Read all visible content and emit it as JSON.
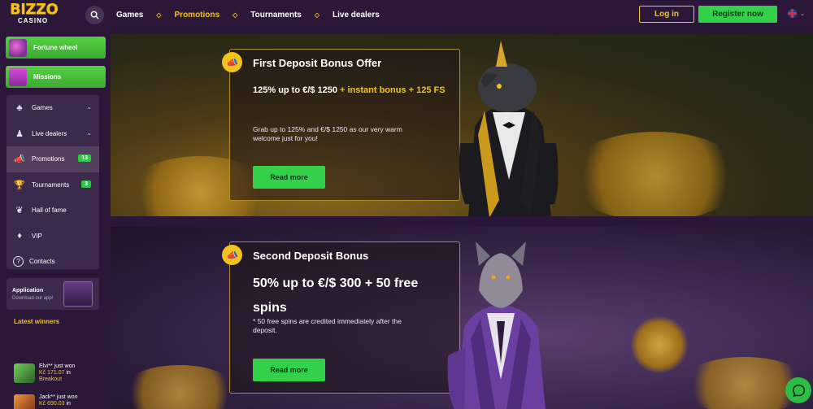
{
  "header": {
    "logo_top": "BIZZO",
    "logo_bottom": "CASINO",
    "nav": [
      {
        "label": "Games",
        "active": false
      },
      {
        "label": "Promotions",
        "active": true
      },
      {
        "label": "Tournaments",
        "active": false
      },
      {
        "label": "Live dealers",
        "active": false
      }
    ],
    "nav_separator": "◇",
    "login_label": "Log in",
    "register_label": "Register now",
    "lang_chevron": "⌄"
  },
  "sidebar": {
    "fortune_wheel": "Fortune wheel",
    "missions": "Missions",
    "menu": [
      {
        "label": "Games",
        "icon": "♣",
        "arrow": "⌄"
      },
      {
        "label": "Live dealers",
        "icon": "♟",
        "arrow": "⌄"
      },
      {
        "label": "Promotions",
        "icon": "📣",
        "badge": "13"
      },
      {
        "label": "Tournaments",
        "icon": "🏆",
        "badge": "3"
      },
      {
        "label": "Hall of fame",
        "icon": "❦"
      },
      {
        "label": "VIP",
        "icon": "♦"
      },
      {
        "label": "Contacts",
        "icon": "?"
      }
    ],
    "app_title": "Application",
    "app_sub": "Download our app!",
    "latest_winners": "Latest winners",
    "winners": [
      {
        "name": "Elvi** just won",
        "amount": "Kč 171.07",
        "in": "in",
        "game": "Breakout"
      },
      {
        "name": "Jack** just won",
        "amount": "Kč 690.03",
        "in": "in",
        "game": ""
      }
    ]
  },
  "promos": [
    {
      "title": "First Deposit Bonus Offer",
      "headline_white": "125% up to €/$ 1250 ",
      "headline_yellow": "+ instant bonus + 125 FS",
      "description": "Grab up to 125% and €/$ 1250 as our very warm welcome just for you!",
      "button": "Read more"
    },
    {
      "title": "Second Deposit Bonus",
      "headline_white": "50% up to €/$ 300 + 50 free spins",
      "description": "* 50 free spins are credited immediately after the deposit.",
      "button": "Read more"
    }
  ],
  "colors": {
    "accent_yellow": "#f3c21b",
    "accent_green": "#33d14a",
    "background": "#2a1638"
  }
}
